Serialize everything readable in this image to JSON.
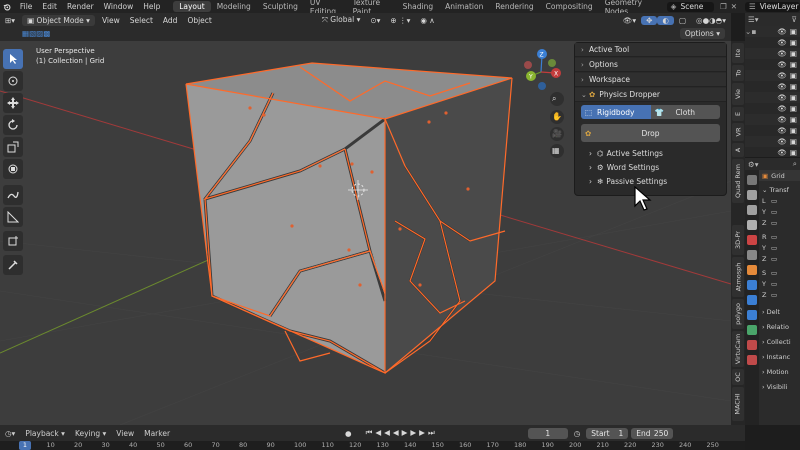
{
  "topbar": {
    "menus": [
      "File",
      "Edit",
      "Render",
      "Window",
      "Help"
    ],
    "workspaces": [
      "Layout",
      "Modeling",
      "Sculpting",
      "UV Editing",
      "Texture Paint",
      "Shading",
      "Animation",
      "Rendering",
      "Compositing",
      "Geometry Nodes"
    ],
    "active_workspace": "Layout",
    "scene_label": "Scene",
    "view_layer_label": "ViewLayer"
  },
  "viewport_header": {
    "mode": "Object Mode",
    "menus": [
      "View",
      "Select",
      "Add",
      "Object"
    ],
    "transform_orientation": "Global",
    "options_label": "Options"
  },
  "viewport": {
    "perspective": "User Perspective",
    "collection_info": "(1) Collection | Grid",
    "colors": {
      "background": "#3d3d3d",
      "selection_outline": "#ff6a2a",
      "x_axis": "#a23a3a",
      "y_axis": "#6b8a2e"
    }
  },
  "npanel": {
    "sections": [
      "Active Tool",
      "Options",
      "Workspace"
    ],
    "addon_title": "Physics Dropper",
    "rigidbody_label": "Rigidbody",
    "cloth_label": "Cloth",
    "drop_label": "Drop",
    "subsections": [
      "Active Settings",
      "Word Settings",
      "Passive Settings"
    ],
    "accent_color": "#4772b3"
  },
  "side_tabs": [
    "Ite",
    "To",
    "Vie",
    "E",
    "VR",
    "A",
    "Quad Rem",
    "3D-Pr",
    "Atmosph",
    "polygo",
    "VirtuCam",
    "OC",
    "MACHI"
  ],
  "properties": {
    "object_name": "Grid",
    "rows": [
      "Transf",
      "L",
      "Y",
      "Z",
      "R",
      "Y",
      "Z",
      "S",
      "Y",
      "Z",
      "Delt",
      "Relatio",
      "Collecti",
      "Instanc",
      "Motion",
      "Visibili"
    ]
  },
  "timeline": {
    "menus": [
      "Playback",
      "Keying",
      "View",
      "Marker"
    ],
    "current_frame": "1",
    "start_label": "Start",
    "start_value": "1",
    "end_label": "End",
    "end_value": "250",
    "ruler_ticks": [
      "1",
      "10",
      "20",
      "30",
      "40",
      "50",
      "60",
      "70",
      "80",
      "90",
      "100",
      "110",
      "120",
      "130",
      "140",
      "150",
      "160",
      "170",
      "180",
      "190",
      "200",
      "210",
      "220",
      "230",
      "240",
      "250"
    ]
  }
}
